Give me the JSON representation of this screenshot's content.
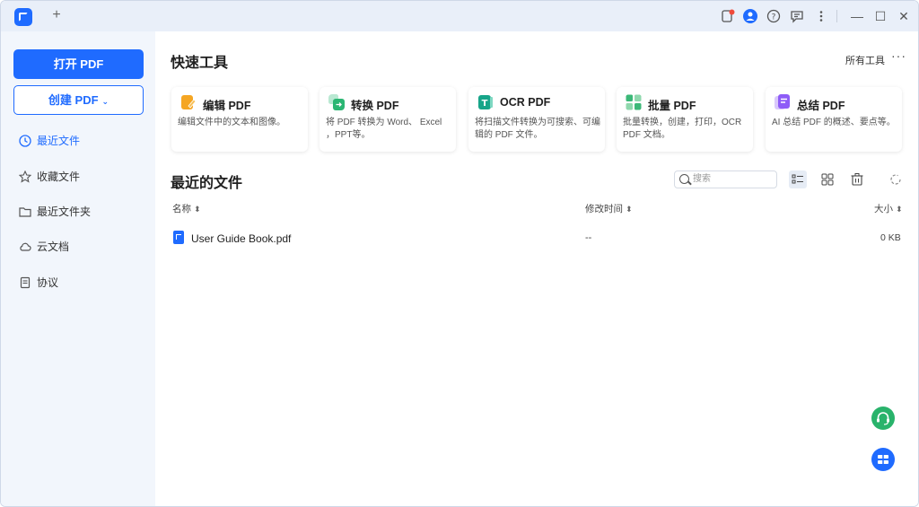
{
  "titlebar": {
    "new_tab_label": "+",
    "icons": [
      "notification-icon",
      "account-icon",
      "help-icon",
      "feedback-icon",
      "more-vertical-icon"
    ],
    "window_controls": {
      "minimize": "—",
      "maximize": "☐",
      "close": "✕"
    }
  },
  "sidebar": {
    "open_pdf": "打开 PDF",
    "create_pdf": "创建 PDF",
    "create_caret": "⌄",
    "items": [
      {
        "label": "最近文件",
        "icon": "clock-icon",
        "active": true
      },
      {
        "label": "收藏文件",
        "icon": "star-icon",
        "active": false
      },
      {
        "label": "最近文件夹",
        "icon": "folder-icon",
        "active": false
      },
      {
        "label": "云文档",
        "icon": "cloud-icon",
        "active": false
      },
      {
        "label": "协议",
        "icon": "document-icon",
        "active": false
      }
    ]
  },
  "quick_tools": {
    "title": "快速工具",
    "all_tools": "所有工具",
    "more": "···",
    "tools": [
      {
        "name": "编辑 PDF",
        "desc": "编辑文件中的文本和图像。",
        "icon": "edit-pdf-icon",
        "color": "#f5a623"
      },
      {
        "name": "转换 PDF",
        "desc": "将 PDF 转换为 Word、 Excel ，PPT等。",
        "icon": "convert-pdf-icon",
        "color": "#2bb673"
      },
      {
        "name": "OCR PDF",
        "desc": "将扫描文件转换为可搜索、可编辑的 PDF 文件。",
        "icon": "ocr-pdf-icon",
        "color": "#17a589"
      },
      {
        "name": "批量 PDF",
        "desc": "批量转换，创建，打印，OCR PDF 文档。",
        "icon": "batch-pdf-icon",
        "color": "#3cb878"
      },
      {
        "name": "总结 PDF",
        "desc": "AI 总结 PDF 的概述、要点等。",
        "icon": "summarize-pdf-icon",
        "color": "#8e5cf7"
      }
    ]
  },
  "recent": {
    "title": "最近的文件",
    "search_placeholder": "搜索",
    "columns": {
      "name": "名称",
      "modified": "修改时间",
      "size": "大小"
    },
    "sort_symbol": "⬍",
    "files": [
      {
        "name": "User Guide Book.pdf",
        "modified": "--",
        "size": "0 KB"
      }
    ]
  },
  "colors": {
    "accent": "#1f6bff",
    "support": "#29b36b",
    "sidebar_bg": "#f2f6fc",
    "titlebar_bg": "#e9eff9"
  }
}
